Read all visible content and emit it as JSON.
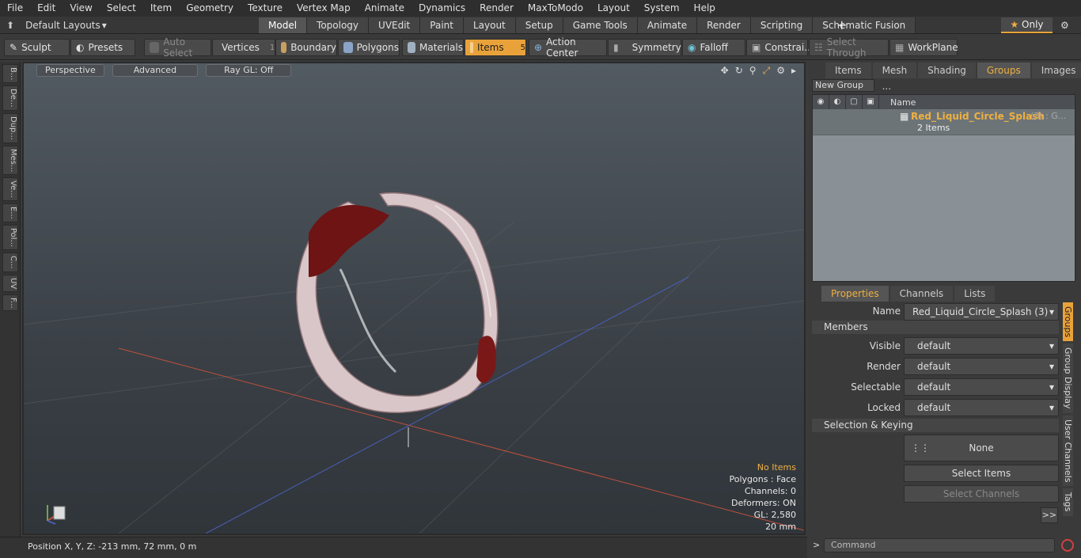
{
  "menu": [
    "File",
    "Edit",
    "View",
    "Select",
    "Item",
    "Geometry",
    "Texture",
    "Vertex Map",
    "Animate",
    "Dynamics",
    "Render",
    "MaxToModo",
    "Layout",
    "System",
    "Help"
  ],
  "layout_select": "Default Layouts",
  "mode_tabs": [
    "Model",
    "Topology",
    "UVEdit",
    "Paint",
    "Layout",
    "Setup",
    "Game Tools",
    "Animate",
    "Render",
    "Scripting",
    "Schematic Fusion"
  ],
  "only_label": "Only",
  "toolbar": {
    "sculpt": "Sculpt",
    "presets": "Presets",
    "auto_select": "Auto Select",
    "vertices": "Vertices",
    "vertices_count": "1",
    "boundary": "Boundary",
    "polygons": "Polygons",
    "materials": "Materials",
    "items": "Items",
    "items_count": "5",
    "action_center": "Action Center",
    "symmetry": "Symmetry",
    "falloff": "Falloff",
    "constraints": "Constrai...",
    "select_through": "Select Through",
    "workplane": "WorkPlane"
  },
  "left_tabs": [
    "B...",
    "De...",
    "Dup...",
    "Mes...",
    "Ve...",
    "E...",
    "Pol...",
    "C...",
    "UV",
    "F..."
  ],
  "viewport": {
    "view": "Perspective",
    "shading": "Advanced",
    "raygl": "Ray GL: Off",
    "stats": {
      "items": "No Items",
      "polygons": "Polygons : Face",
      "channels": "Channels: 0",
      "deformers": "Deformers: ON",
      "gl": "GL: 2,580",
      "scale": "20 mm"
    }
  },
  "status": "Position X, Y, Z:   -213 mm, 72 mm, 0 m",
  "top_panel_tabs": [
    "Items",
    "Mesh ...",
    "Shading",
    "Groups",
    "Images"
  ],
  "new_group": "New Group",
  "group_col_name": "Name",
  "group": {
    "name": "Red_Liquid_Circle_Splash",
    "suffix": "(3) : G...",
    "count": "2 Items"
  },
  "prop_tabs": [
    "Properties",
    "Channels",
    "Lists"
  ],
  "props": {
    "name_label": "Name",
    "name_value": "Red_Liquid_Circle_Splash (3)",
    "members": "Members",
    "visible_label": "Visible",
    "visible": "default",
    "render_label": "Render",
    "render": "default",
    "selectable_label": "Selectable",
    "selectable": "default",
    "locked_label": "Locked",
    "locked": "default",
    "selection_keying": "Selection & Keying",
    "none": "None",
    "select_items": "Select Items",
    "select_channels": "Select Channels",
    "more": ">>"
  },
  "side_tabs": [
    "Groups",
    "Group Display",
    "User Channels",
    "Tags"
  ],
  "command_placeholder": "Command"
}
